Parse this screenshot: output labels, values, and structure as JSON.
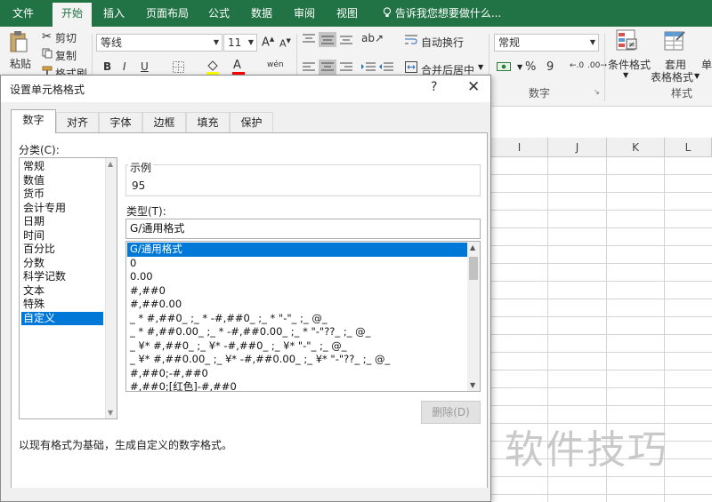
{
  "tabs": [
    "文件",
    "开始",
    "插入",
    "页面布局",
    "公式",
    "数据",
    "审阅",
    "视图"
  ],
  "tell_me": "告诉我您想要做什么...",
  "ribbon": {
    "paste": "粘贴",
    "cut": "剪切",
    "copy": "复制",
    "format_painter": "格式刷",
    "font_name": "等线",
    "font_size": "11",
    "bold": "B",
    "italic": "I",
    "underline": "U",
    "wrap_text": "自动换行",
    "merge_center": "合并后居中",
    "number_format": "常规",
    "number_group": "数字",
    "percent": "%",
    "comma": "9",
    "cond_format": "条件格式",
    "table_format_1": "套用",
    "table_format_2": "表格格式",
    "styles_group": "样式",
    "cut_off": "单"
  },
  "columns": [
    "I",
    "J",
    "K",
    "L"
  ],
  "dialog": {
    "title": "设置单元格格式",
    "help": "?",
    "close": "✕",
    "tabs": [
      "数字",
      "对齐",
      "字体",
      "边框",
      "填充",
      "保护"
    ],
    "category_label": "分类(C):",
    "categories": [
      "常规",
      "数值",
      "货币",
      "会计专用",
      "日期",
      "时间",
      "百分比",
      "分数",
      "科学记数",
      "文本",
      "特殊",
      "自定义"
    ],
    "selected_category": "自定义",
    "sample_label": "示例",
    "sample_value": "95",
    "type_label": "类型(T):",
    "type_value": "G/通用格式",
    "formats": [
      "G/通用格式",
      "0",
      "0.00",
      "#,##0",
      "#,##0.00",
      "_ * #,##0_ ;_ * -#,##0_ ;_ * \"-\"_ ;_ @_",
      "_ * #,##0.00_ ;_ * -#,##0.00_ ;_ * \"-\"??_ ;_ @_",
      "_ ¥* #,##0_ ;_ ¥* -#,##0_ ;_ ¥* \"-\"_ ;_ @_",
      "_ ¥* #,##0.00_ ;_ ¥* -#,##0.00_ ;_ ¥* \"-\"??_ ;_ @_",
      "#,##0;-#,##0",
      "#,##0;[红色]-#,##0"
    ],
    "delete_button": "删除(D)",
    "description": "以现有格式为基础，生成自定义的数字格式。"
  },
  "watermark": "软件技巧",
  "colors": {
    "excel_green": "#217346",
    "selection_blue": "#0078d7"
  }
}
